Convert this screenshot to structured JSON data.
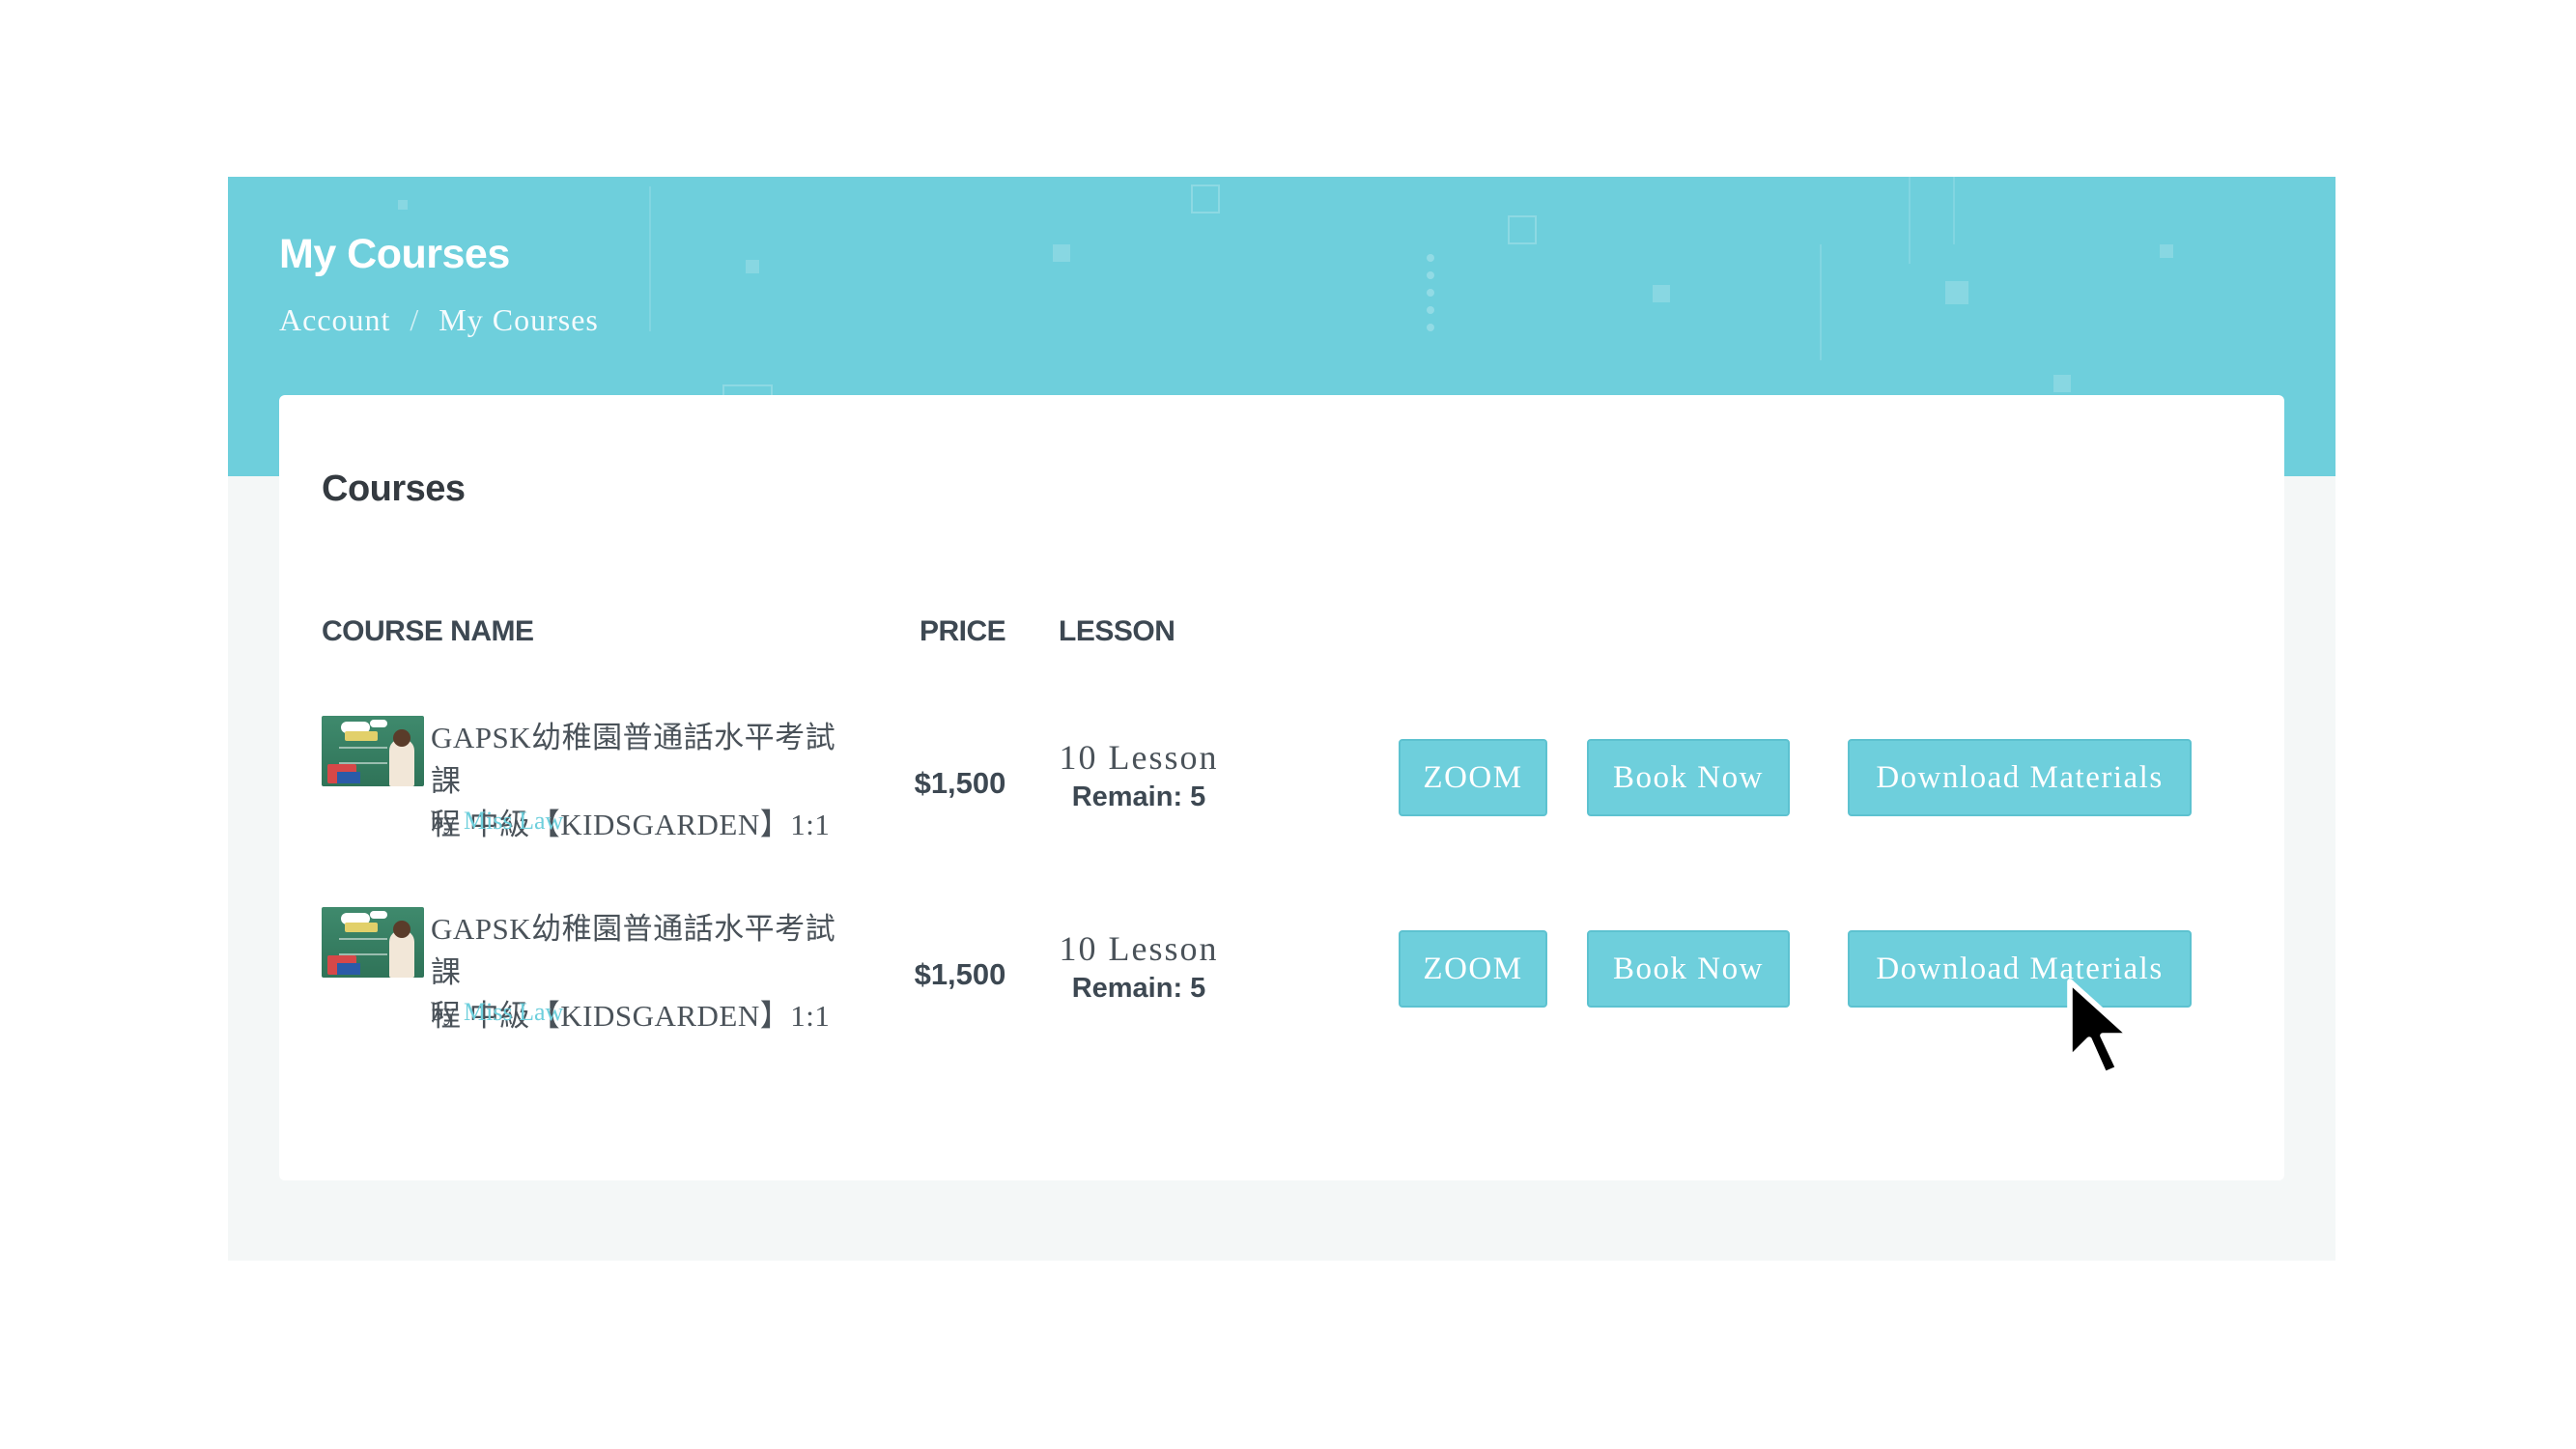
{
  "page": {
    "title": "My Courses",
    "breadcrumb": {
      "items": [
        "Account",
        "My Courses"
      ],
      "separator": "/"
    }
  },
  "card": {
    "title": "Courses",
    "columns": {
      "name": "COURSE NAME",
      "price": "PRICE",
      "lesson": "LESSON"
    }
  },
  "courses": [
    {
      "title_line1": "GAPSK幼稚園普通話水平考試課",
      "title_line2": "程 中級【KIDSGARDEN】1:1",
      "by_label": "by",
      "author": "Miss Law",
      "price": "$1,500",
      "lesson_count": "10 Lesson",
      "remain": "Remain: 5",
      "buttons": {
        "zoom": "ZOOM",
        "book": "Book Now",
        "download": "Download Materials"
      }
    },
    {
      "title_line1": "GAPSK幼稚園普通話水平考試課",
      "title_line2": "程 中級【KIDSGARDEN】1:1",
      "by_label": "by",
      "author": "Miss Law",
      "price": "$1,500",
      "lesson_count": "10 Lesson",
      "remain": "Remain: 5",
      "buttons": {
        "zoom": "ZOOM",
        "book": "Book Now",
        "download": "Download Materials"
      }
    }
  ],
  "theme": {
    "accent": "#6ecfdc",
    "heading": "#343a40",
    "text": "#4a5259",
    "page_bg": "#f4f7f7"
  },
  "icons": {
    "cursor": "mouse-pointer-icon"
  }
}
